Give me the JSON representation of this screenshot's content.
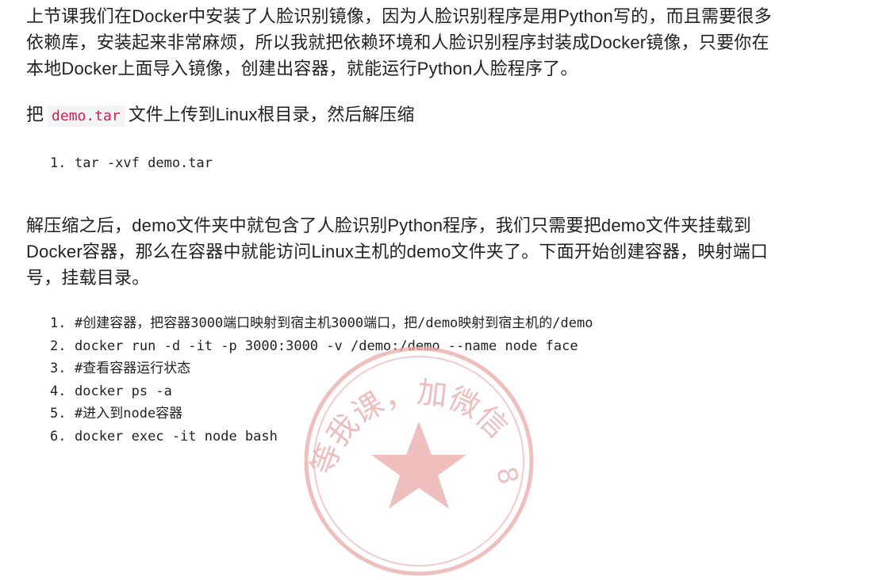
{
  "paragraph1": {
    "line1": "上节课我们在Docker中安装了人脸识别镜像，因为人脸识别程序是用Python写的，而且需要很多",
    "line2": "依赖库，安装起来非常麻烦，所以我就把依赖环境和人脸识别程序封装成Docker镜像，只要你在",
    "line3": "本地Docker上面导入镜像，创建出容器，就能运行Python人脸程序了。"
  },
  "upload_line": {
    "prefix": "把",
    "code": "demo.tar",
    "suffix": "文件上传到Linux根目录，然后解压缩"
  },
  "code_block_1": [
    {
      "num": "1.",
      "text": "tar -xvf demo.tar"
    }
  ],
  "paragraph2": {
    "line1": "解压缩之后，demo文件夹中就包含了人脸识别Python程序，我们只需要把demo文件夹挂载到",
    "line2": "Docker容器，那么在容器中就能访问Linux主机的demo文件夹了。下面开始创建容器，映射端口",
    "line3": "号，挂载目录。"
  },
  "code_block_2": [
    {
      "num": "1.",
      "text": "#创建容器，把容器3000端口映射到宿主机3000端口，把/demo映射到宿主机的/demo"
    },
    {
      "num": "2.",
      "text": "docker run -d -it -p 3000:3000 -v /demo:/demo --name node face"
    },
    {
      "num": "3.",
      "text": "#查看容器运行状态"
    },
    {
      "num": "4.",
      "text": "docker ps -a"
    },
    {
      "num": "5.",
      "text": "#进入到node容器"
    },
    {
      "num": "6.",
      "text": "docker exec -it node bash"
    }
  ],
  "watermark": {
    "text": "等我课，加微信",
    "color": "#d9534f"
  }
}
